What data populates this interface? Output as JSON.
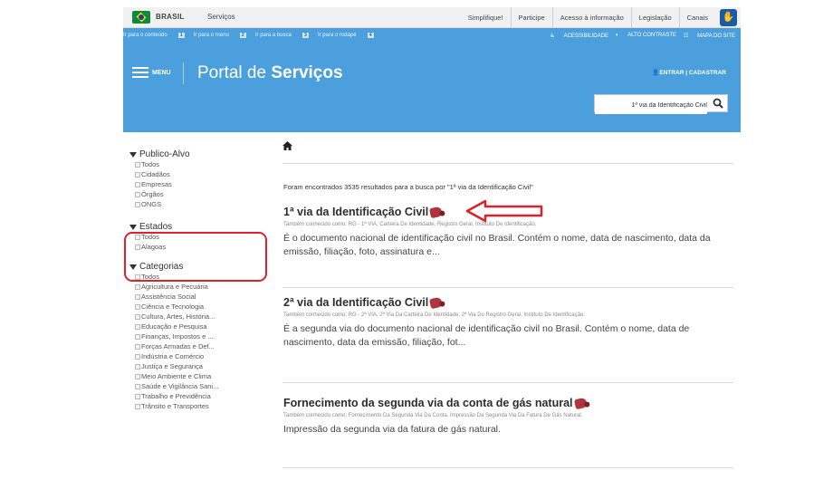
{
  "govbar": {
    "brand": "BRASIL",
    "services": "Serviços",
    "links": [
      "Simplifique!",
      "Participe",
      "Acesso à informação",
      "Legislação",
      "Canais"
    ]
  },
  "header": {
    "skip_links": [
      {
        "text": "Ir para o conteúdo",
        "key": "1"
      },
      {
        "text": "Ir para o menu",
        "key": "2"
      },
      {
        "text": "Ir para a busca",
        "key": "3"
      },
      {
        "text": "Ir para o rodapé",
        "key": "4"
      }
    ],
    "accessibility": "ACESSIBILIDADE",
    "contrast": "ALTO CONTRASTE",
    "sitemap": "MAPA DO SITE",
    "menu_label": "MENU",
    "portal_prefix": "Portal de",
    "portal_bold": "Serviços",
    "login": "ENTRAR | CADASTRAR",
    "search_value": "1ª via da Identificação Civil"
  },
  "sidebar": {
    "facets": [
      {
        "title": "Publico-Alvo",
        "items": [
          "Todos",
          "Cidadãos",
          "Empresas",
          "Órgãos",
          "ONGS"
        ]
      },
      {
        "title": "Estados",
        "items": [
          "Todos",
          "Alagoas"
        ]
      },
      {
        "title": "Categorias",
        "items": [
          "Todos",
          "Agricultura e Pecuária",
          "Assistência Social",
          "Ciência e Tecnologia",
          "Cultura, Artes, História...",
          "Educação e Pesquisa",
          "Finanças, Impostos e ...",
          "Forças Armadas e Def...",
          "Indústria e Comércio",
          "Justiça e Segurança",
          "Meio Ambiente e Clima",
          "Saúde e Vigilância Sani...",
          "Trabalho e Previdência",
          "Trânsito e Transportes"
        ]
      }
    ]
  },
  "main": {
    "summary": "Foram encontrados 3535 resultados para a busca por \"1ª via da Identificação Civil\"",
    "results": [
      {
        "title": "1ª via da Identificação Civil",
        "aka": "Também conhecido como: RG - 1ª VIA, Carteira De Identidade, Registro Geral, Instituto De Identificação.",
        "desc": "É o documento nacional de identificação civil no Brasil. Contém o nome, data de nascimento, data da emissão, filiação, foto, assinatura e..."
      },
      {
        "title": "2ª via da Identificação Civil",
        "aka": "Também conhecido como: RG - 2ª VIA, 2ª Via Da Carteira De Identidade, 2ª Via Do Registro Geral, Instituto De Identificação.",
        "desc": "É a segunda via do documento nacional de identificação civil no Brasil. Contém o nome, data de nascimento, data da emissão, filiação, fot..."
      },
      {
        "title": "Fornecimento da segunda via da conta de gás natural",
        "aka": "Também conhecido como: Fornecimento Da Segunda Via Da Conta, Impressão Da Segunda Via Da Fatura De Gás Natural.",
        "desc": "Impressão da segunda via da fatura de gás natural."
      }
    ]
  },
  "colors": {
    "header_blue": "#4a9fdc",
    "annotation_red": "#e0202a",
    "tag_red": "#b0343e"
  },
  "icons": [
    "flag-icon",
    "accessibility-icon",
    "hamburger-icon",
    "user-icon",
    "search-icon",
    "home-icon",
    "funnel-icon",
    "checkbox-icon",
    "tag-icon",
    "arrow-icon"
  ]
}
